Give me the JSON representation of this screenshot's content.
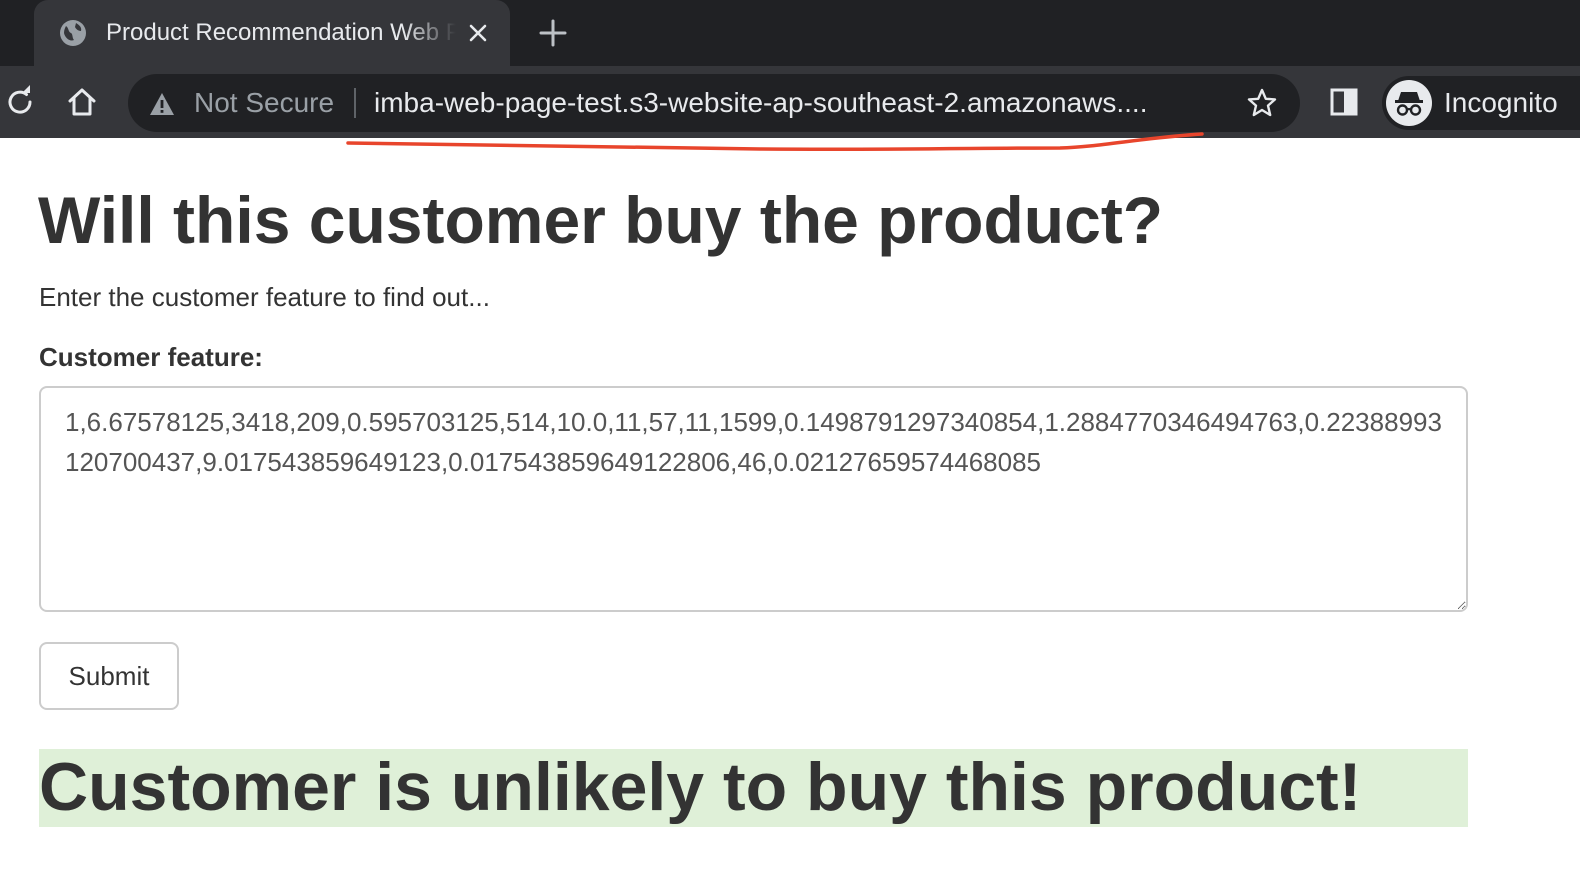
{
  "browser": {
    "tab": {
      "title": "Product Recommendation Web Page",
      "favicon": "globe-icon"
    },
    "toolbar": {
      "security_label": "Not Secure",
      "url": "imba-web-page-test.s3-website-ap-southeast-2.amazonaws....",
      "profile_label": "Incognito"
    }
  },
  "page": {
    "title": "Will this customer buy the product?",
    "subtitle": "Enter the customer feature to find out...",
    "feature_label": "Customer feature:",
    "feature_value": "1,6.67578125,3418,209,0.595703125,514,10.0,11,57,11,1599,0.1498791297340854,1.2884770346494763,0.22388993120700437,9.017543859649123,0.017543859649122806,46,0.02127659574468085",
    "submit_label": "Submit",
    "result": "Customer is unlikely to buy this product!"
  },
  "colors": {
    "chrome_dark": "#202124",
    "chrome_toolbar": "#35363a",
    "result_background": "#dff0d8",
    "annotation_red": "#e8452c",
    "text": "#333333"
  }
}
